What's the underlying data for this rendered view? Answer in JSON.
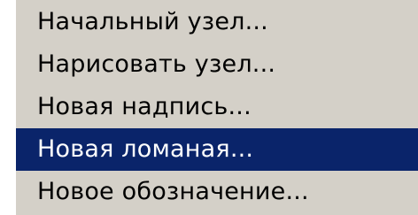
{
  "menu": {
    "items": [
      {
        "label": "Начальный узел..."
      },
      {
        "label": "Нарисовать узел..."
      },
      {
        "label": "Новая надпись..."
      },
      {
        "label": "Новая ломаная...",
        "highlighted": true
      },
      {
        "label": "Новое обозначение..."
      }
    ]
  },
  "colors": {
    "menu_background": "#d4d0c8",
    "highlight_background": "#0a246a",
    "highlight_text": "#ffffff",
    "text": "#000000"
  }
}
